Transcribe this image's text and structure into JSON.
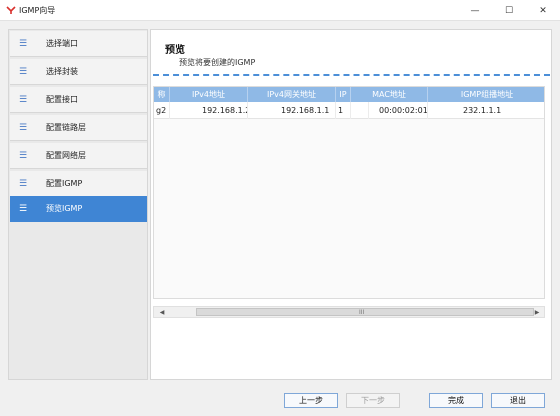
{
  "window": {
    "title": "IGMP向导",
    "minimize": "—",
    "maximize": "☐",
    "close": "✕"
  },
  "sidebar": {
    "items": [
      {
        "label": "选择端口",
        "icon": "menu-lines-icon"
      },
      {
        "label": "选择封装",
        "icon": "menu-lines-icon"
      },
      {
        "label": "配置接口",
        "icon": "menu-lines-icon"
      },
      {
        "label": "配置链路层",
        "icon": "menu-lines-icon"
      },
      {
        "label": "配置网络层",
        "icon": "menu-lines-icon"
      },
      {
        "label": "配置IGMP",
        "icon": "menu-lines-icon"
      },
      {
        "label": "预览IGMP",
        "icon": "menu-lines-icon",
        "active": true
      }
    ],
    "icon_glyph": "☰"
  },
  "preview": {
    "title": "预览",
    "subtitle": "预览将要创建的IGMP"
  },
  "table": {
    "columns": [
      "称",
      "IPv4地址",
      "IPv4网关地址",
      "IP",
      "MAC地址",
      "IGMP组播地址"
    ],
    "rows": [
      [
        "g2",
        "192.168.1.2",
        "192.168.1.1",
        "1",
        "00:00:02:01:01:02",
        "232.1.1.1"
      ]
    ]
  },
  "scrollbar": {
    "left_arrow": "◀",
    "right_arrow": "▶",
    "grip": "III"
  },
  "buttons": {
    "prev": "上一步",
    "next": "下一步",
    "finish": "完成",
    "exit": "退出"
  },
  "colors": {
    "accent": "#3f85d4",
    "header": "#8fb9e6",
    "logo": "#d9302c"
  }
}
